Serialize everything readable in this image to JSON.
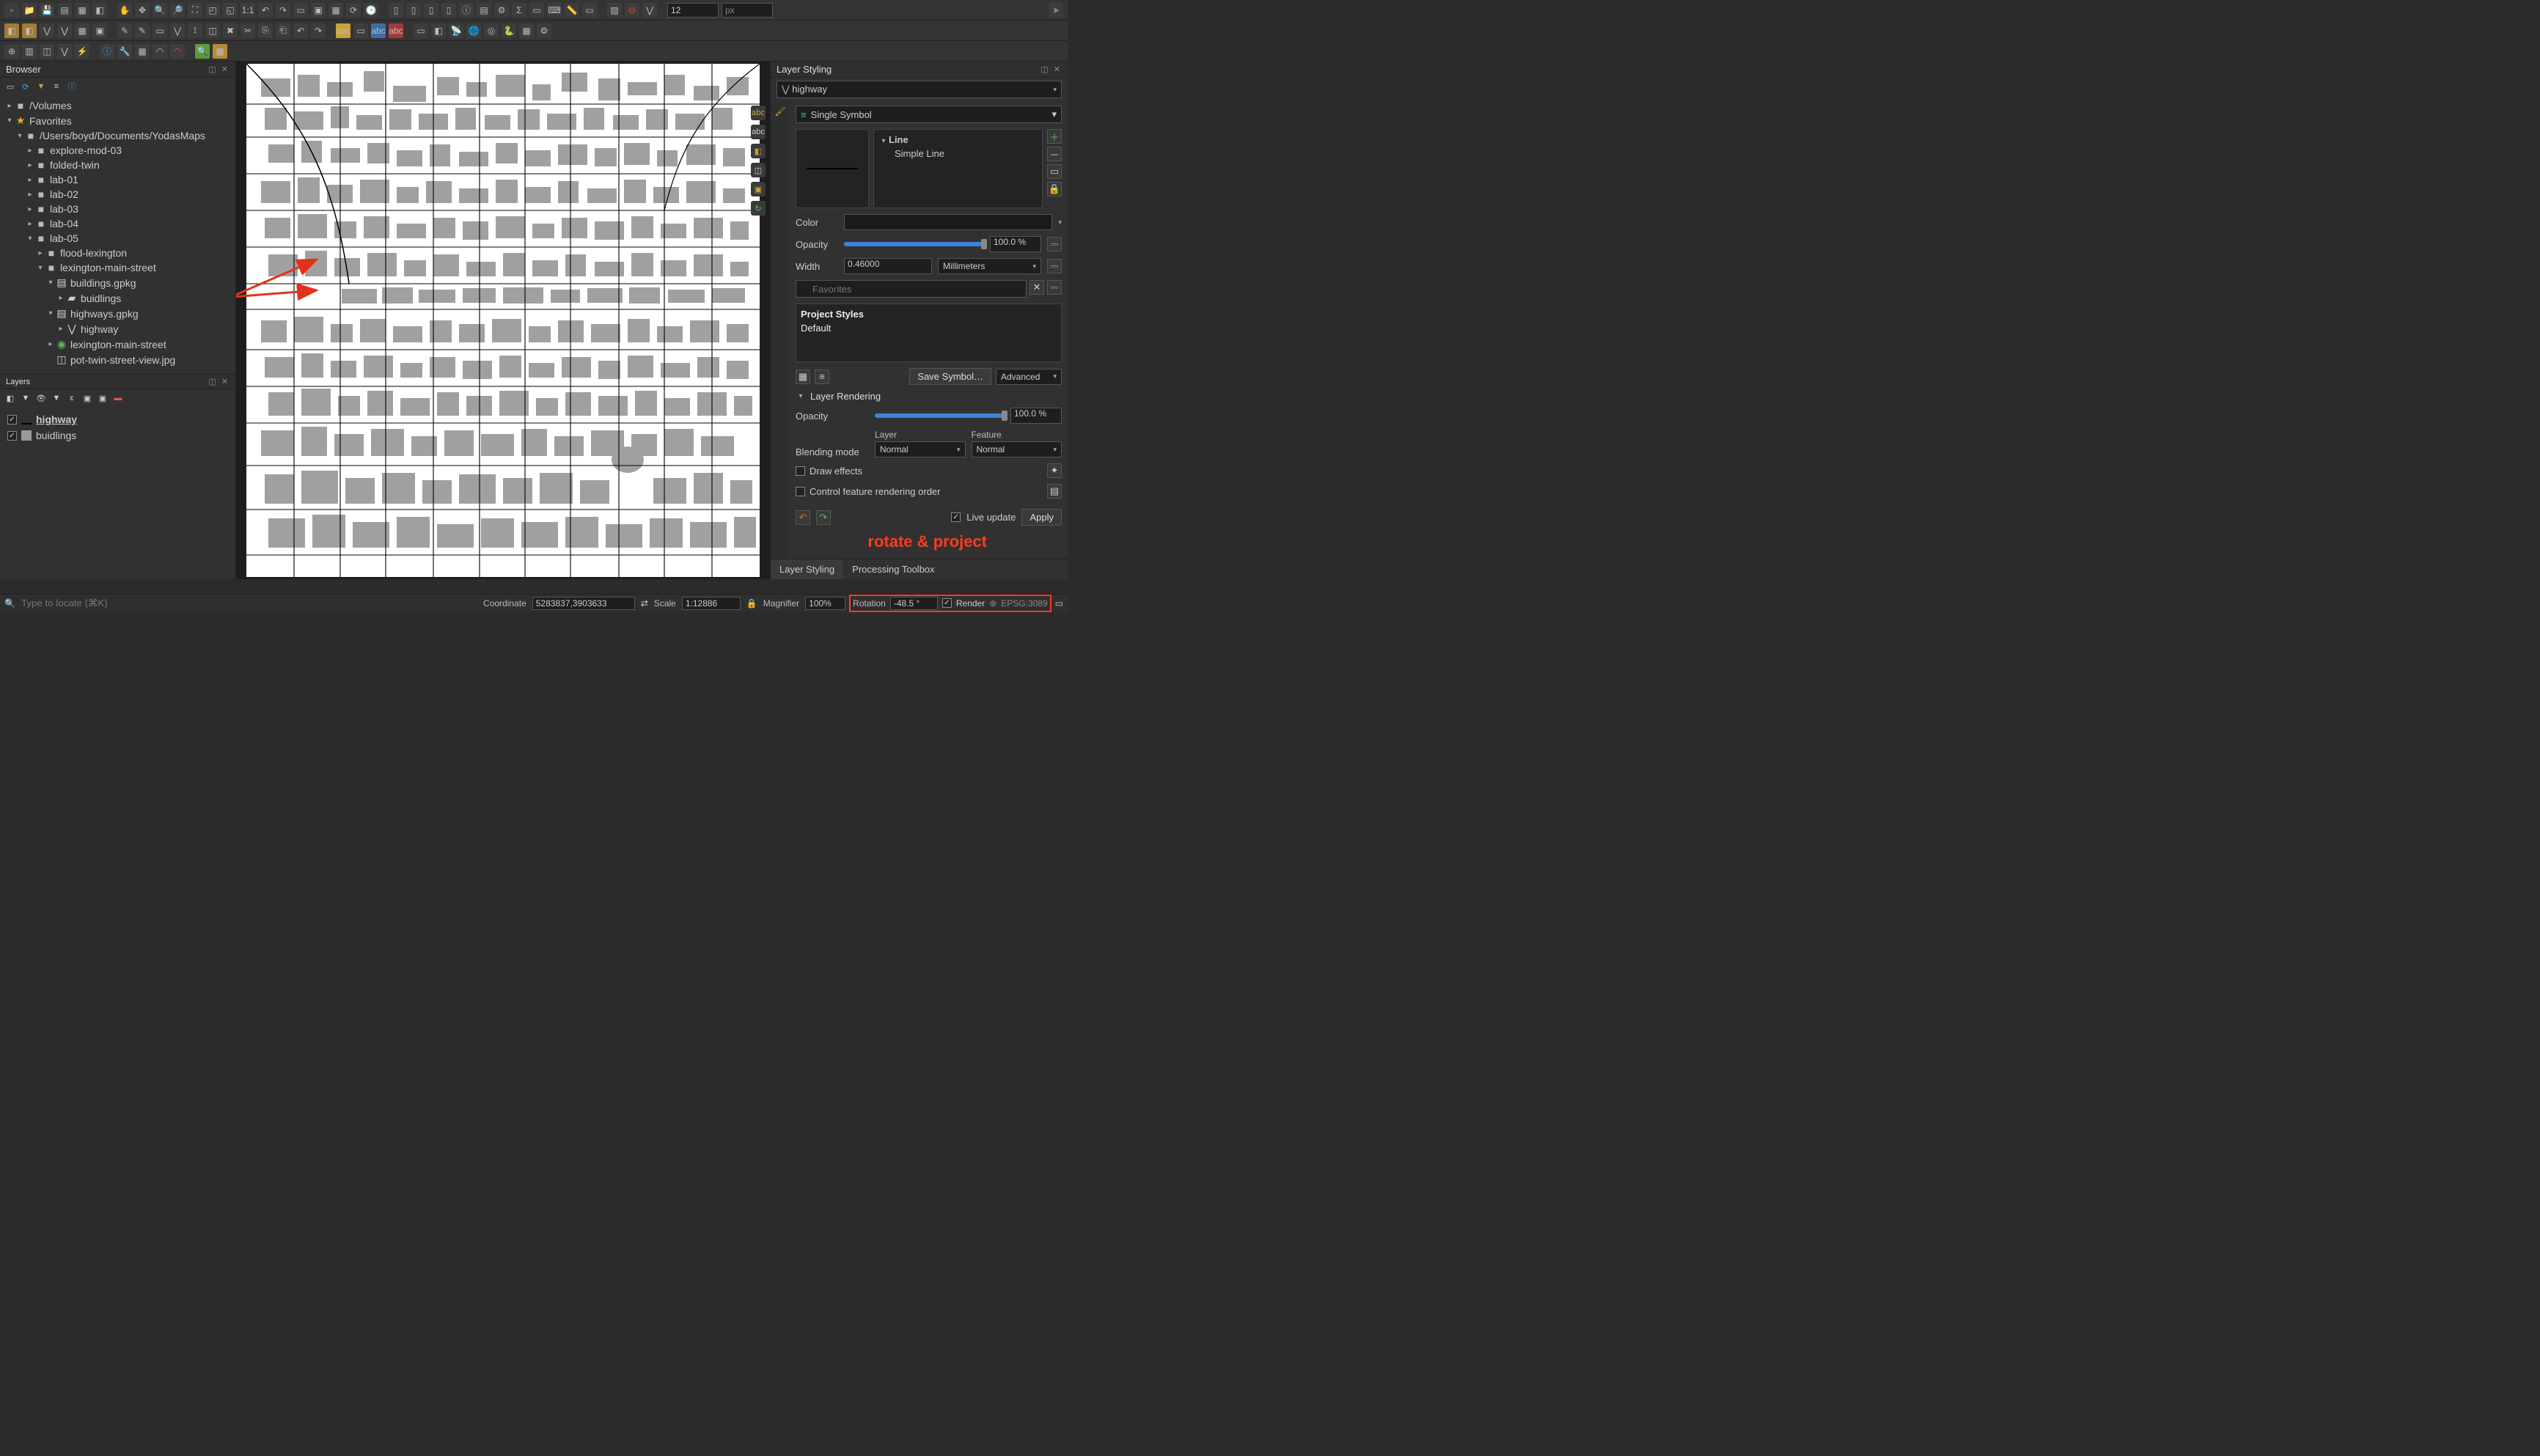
{
  "toolbar": {
    "font_size": "12",
    "px_unit": "px"
  },
  "browser": {
    "title": "Browser",
    "tree": {
      "volumes": "/Volumes",
      "favorites": "Favorites",
      "yodas": "/Users/boyd/Documents/YodasMaps",
      "folders": [
        "explore-mod-03",
        "folded-twin",
        "lab-01",
        "lab-02",
        "lab-03",
        "lab-04",
        "lab-05"
      ],
      "lab05": {
        "flood": "flood-lexington",
        "lex_main": "lexington-main-street",
        "buildings_gpkg": "buildings.gpkg",
        "buildings_layer": "buidlings",
        "highways_gpkg": "highways.gpkg",
        "highway_layer": "highway",
        "lex_main_green": "lexington-main-street",
        "pot_jpg": "pot-twin-street-view.jpg"
      }
    }
  },
  "layers": {
    "title": "Layers",
    "items": [
      {
        "name": "highway",
        "active": true,
        "swatch": "#000"
      },
      {
        "name": "buidlings",
        "active": false,
        "swatch": "#9a9a9a"
      }
    ]
  },
  "styling": {
    "title": "Layer Styling",
    "layer_selected": "highway",
    "symbol_mode": "Single Symbol",
    "symbol_tree": {
      "root": "Line",
      "child": "Simple Line"
    },
    "color_label": "Color",
    "opacity_label": "Opacity",
    "opacity_value": "100.0 %",
    "width_label": "Width",
    "width_value": "0.46000",
    "width_unit": "Millimeters",
    "favorites_placeholder": "Favorites",
    "project_styles": "Project Styles",
    "default_style": "Default",
    "save_symbol": "Save Symbol…",
    "advanced": "Advanced",
    "layer_rendering": "Layer Rendering",
    "lr_opacity_label": "Opacity",
    "lr_opacity_value": "100.0 %",
    "blending_label": "Blending mode",
    "layer_col": "Layer",
    "feature_col": "Feature",
    "blending_normal": "Normal",
    "draw_effects": "Draw effects",
    "control_order": "Control feature rendering order",
    "live_update": "Live update",
    "apply": "Apply",
    "tab_styling": "Layer Styling",
    "tab_toolbox": "Processing Toolbox"
  },
  "annotation": {
    "rotate_project": "rotate & project"
  },
  "statusbar": {
    "locate_placeholder": "Type to locate (⌘K)",
    "coordinate_label": "Coordinate",
    "coordinate_value": "5283837,3903633",
    "scale_label": "Scale",
    "scale_value": "1:12886",
    "magnifier_label": "Magnifier",
    "magnifier_value": "100%",
    "rotation_label": "Rotation",
    "rotation_value": "-48.5 °",
    "render_label": "Render",
    "epsg": "EPSG:3089"
  }
}
